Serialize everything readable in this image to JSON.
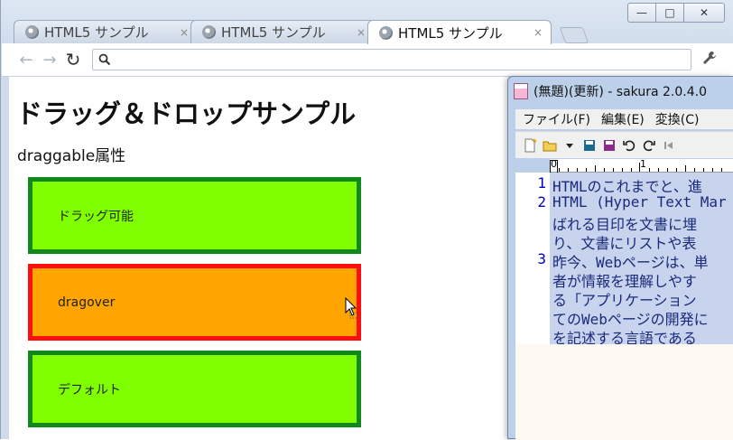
{
  "browser": {
    "tabs": [
      {
        "title": "HTML5 サンプル",
        "close": "×"
      },
      {
        "title": "HTML5 サンプル",
        "close": "×"
      },
      {
        "title": "HTML5 サンプル",
        "close": "×"
      }
    ],
    "controls": {
      "minimize": "—",
      "maximize": "□",
      "close": "✕"
    },
    "nav": {
      "back": "←",
      "forward": "→",
      "reload": "↻"
    },
    "address": {
      "value": "",
      "search_glyph": "🔍"
    },
    "menu_glyph": "🔧"
  },
  "page": {
    "title": "ドラッグ＆ドロップサンプル",
    "section": "draggable属性",
    "boxes": [
      {
        "label": "ドラッグ可能",
        "state": "draggable"
      },
      {
        "label": "dragover",
        "state": "dragover"
      },
      {
        "label": "デフォルト",
        "state": "default"
      }
    ],
    "colors": {
      "green": "#7fff00",
      "green_border": "#118a1b",
      "orange": "#ffa500",
      "red_border": "#ff0d0d"
    }
  },
  "editor": {
    "title": "(無題)(更新) - sakura 2.0.4.0",
    "menu": [
      "ファイル(F)",
      "編集(E)",
      "変換(C)"
    ],
    "ruler": {
      "marks": [
        "0",
        "1"
      ]
    },
    "lines": [
      {
        "num": "1",
        "text": "HTMLのこれまでと、進"
      },
      {
        "num": "2",
        "text": "HTML (Hyper Text Mar"
      },
      {
        "num": "",
        "text": "ばれる目印を文書に埋"
      },
      {
        "num": "",
        "text": "り、文書にリストや表"
      },
      {
        "num": "3",
        "text": "昨今、Webページは、単"
      },
      {
        "num": "",
        "text": "者が情報を理解しやす"
      },
      {
        "num": "",
        "text": "る「アプリケーション"
      },
      {
        "num": "",
        "text": "てのWebページの開発に"
      },
      {
        "num": "",
        "text": "を記述する言語である"
      }
    ]
  }
}
